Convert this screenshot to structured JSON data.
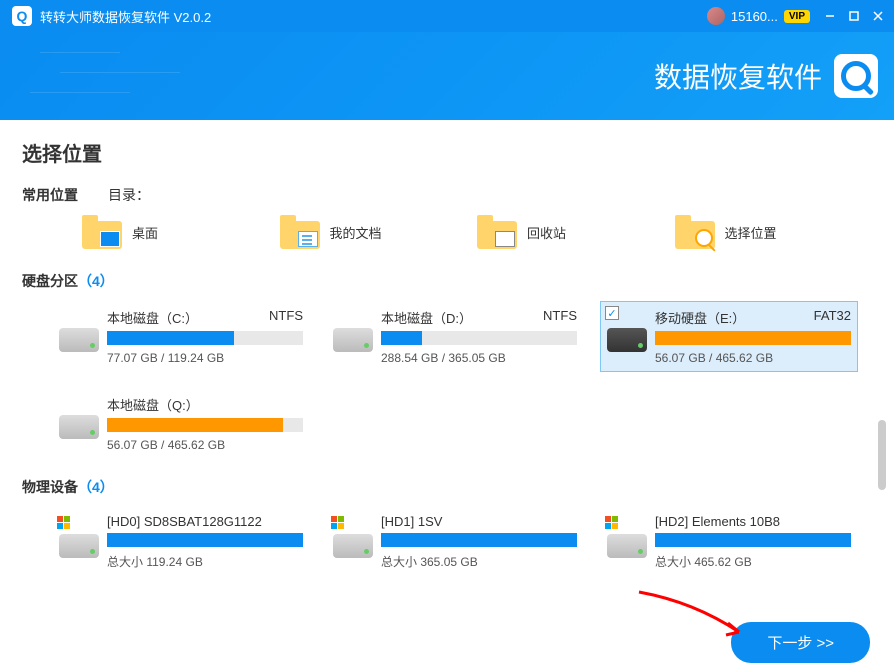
{
  "titlebar": {
    "app_title": "转转大师数据恢复软件 V2.0.2",
    "username": "15160...",
    "vip_label": "VIP"
  },
  "header": {
    "brand_text": "数据恢复软件"
  },
  "main": {
    "page_title": "选择位置",
    "common": {
      "section_title": "常用位置",
      "dir_label": "目录：",
      "items": [
        {
          "label": "桌面"
        },
        {
          "label": "我的文档"
        },
        {
          "label": "回收站"
        },
        {
          "label": "选择位置"
        }
      ]
    },
    "partitions": {
      "section_title": "硬盘分区",
      "count_text": "（4）",
      "items": [
        {
          "name": "本地磁盘（C:）",
          "fs": "NTFS",
          "used_pct": 65,
          "color": "blue",
          "size": "77.07 GB / 119.24 GB",
          "selected": false,
          "ext": false
        },
        {
          "name": "本地磁盘（D:）",
          "fs": "NTFS",
          "used_pct": 21,
          "color": "blue",
          "size": "288.54 GB / 365.05 GB",
          "selected": false,
          "ext": false
        },
        {
          "name": "移动硬盘（E:）",
          "fs": "FAT32",
          "used_pct": 100,
          "color": "orange",
          "size": "56.07 GB / 465.62 GB",
          "selected": true,
          "ext": true
        },
        {
          "name": "本地磁盘（Q:）",
          "fs": "",
          "used_pct": 90,
          "color": "orange",
          "size": "56.07 GB / 465.62 GB",
          "selected": false,
          "ext": false
        }
      ]
    },
    "physical": {
      "section_title": "物理设备",
      "count_text": "（4）",
      "size_prefix": "总大小",
      "items": [
        {
          "name": "[HD0] SD8SBAT128G1122",
          "used_pct": 100,
          "size": "119.24 GB"
        },
        {
          "name": "[HD1] 1SV",
          "used_pct": 100,
          "size": "365.05 GB"
        },
        {
          "name": "[HD2] Elements 10B8",
          "used_pct": 100,
          "size": "465.62 GB"
        }
      ]
    }
  },
  "footer": {
    "next_label": "下一步 >>"
  }
}
